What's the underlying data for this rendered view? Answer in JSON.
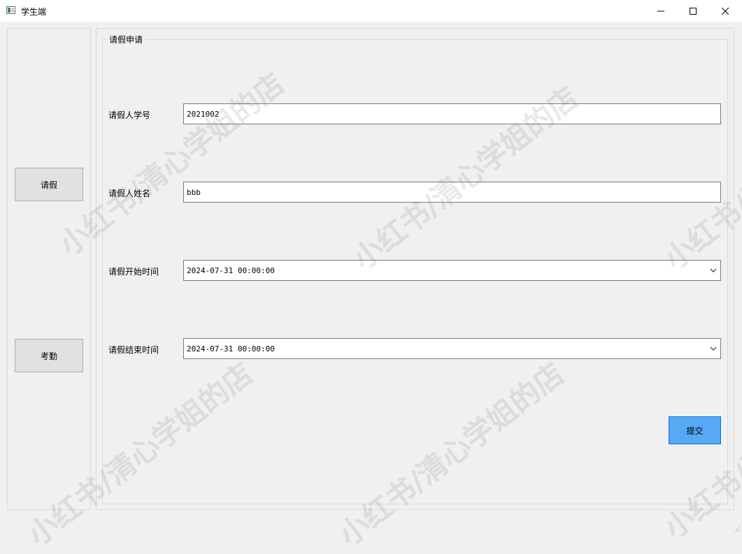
{
  "window": {
    "title": "学生端",
    "icons": {
      "app": "app-window-icon",
      "minimize": "minimize-icon",
      "maximize": "maximize-icon",
      "close": "close-icon"
    }
  },
  "nav": {
    "leave_label": "请假",
    "attendance_label": "考勤"
  },
  "form": {
    "group_title": "请假申请",
    "student_id": {
      "label": "请假人学号",
      "value": "2021002"
    },
    "student_name": {
      "label": "请假人姓名",
      "value": "bbb"
    },
    "start_time": {
      "label": "请假开始时间",
      "value": "2024-07-31 00:00:00"
    },
    "end_time": {
      "label": "请假结束时间",
      "value": "2024-07-31 00:00:00"
    },
    "submit_label": "提交"
  },
  "watermark": {
    "text": "小红书/清心学姐的店"
  },
  "colors": {
    "accent": "#56a9f4",
    "accent_border": "#0078d7",
    "background": "#f0f0f0"
  }
}
